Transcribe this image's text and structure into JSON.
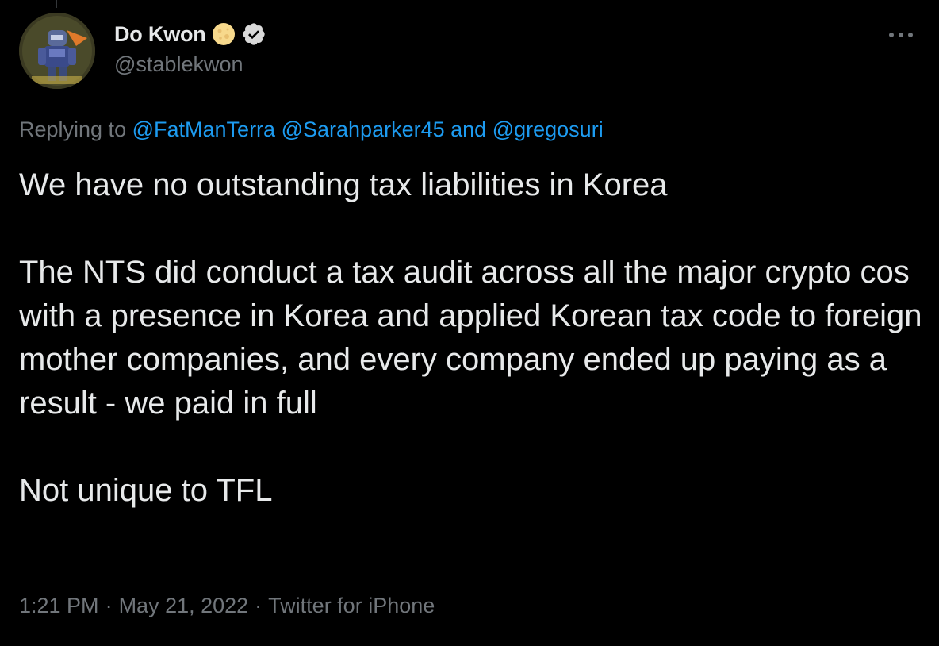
{
  "author": {
    "display_name": "Do Kwon",
    "handle": "@stablekwon",
    "name_emoji": "moon-emoji-icon",
    "verified": true
  },
  "reply": {
    "prefix": "Replying to",
    "mentions": [
      "@FatManTerra",
      "@Sarahparker45"
    ],
    "conjunction": "and",
    "last_mention": "@gregosuri"
  },
  "tweet": {
    "paragraph_1": "We have no outstanding tax liabilities in Korea",
    "paragraph_2": "The NTS did conduct a tax audit across all the major crypto cos with a presence in Korea and applied Korean tax code to foreign mother companies, and every company ended up paying as a result - we paid in full",
    "paragraph_3": "Not unique to TFL"
  },
  "meta": {
    "time": "1:21 PM",
    "date": "May 21, 2022",
    "source": "Twitter for iPhone"
  },
  "colors": {
    "background": "#000000",
    "text": "#e7e9ea",
    "secondary": "#71767b",
    "link": "#1d9bf0"
  },
  "icons": {
    "more": "more-horizontal-icon",
    "verified": "verified-badge-icon"
  }
}
